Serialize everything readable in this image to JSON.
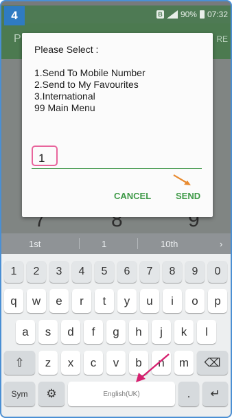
{
  "step_badge": "4",
  "status_bar": {
    "b_icon": "B",
    "battery": "90%",
    "time": "07:32"
  },
  "app_behind": {
    "left_text": "P",
    "right_text": "RE",
    "digits": [
      "7",
      "8",
      "9"
    ]
  },
  "dialog": {
    "title": "Please Select :",
    "items": [
      "1.Send To Mobile Number",
      "2.Send to My Favourites",
      "3.International",
      "99 Main Menu"
    ],
    "input_value": "1",
    "cancel": "CANCEL",
    "send": "SEND"
  },
  "keyboard": {
    "suggestions": [
      "1st",
      "1",
      "10th"
    ],
    "suggestion_more": "›",
    "number_row": [
      "1",
      "2",
      "3",
      "4",
      "5",
      "6",
      "7",
      "8",
      "9",
      "0"
    ],
    "row1": [
      "q",
      "w",
      "e",
      "r",
      "t",
      "y",
      "u",
      "i",
      "o",
      "p"
    ],
    "row2": [
      "a",
      "s",
      "d",
      "f",
      "g",
      "h",
      "j",
      "k",
      "l"
    ],
    "row3": [
      "z",
      "x",
      "c",
      "v",
      "b",
      "n",
      "m"
    ],
    "shift": "⇧",
    "backspace": "⌫",
    "sym": "Sym",
    "settings": "⚙",
    "space": "English(UK)",
    "period": ".",
    "enter": "↵"
  },
  "colors": {
    "frame_border": "#4a8fd4",
    "status_bar": "#4e7a54",
    "dialog_accent": "#3f9a48",
    "highlight": "#e8659c",
    "arrow_orange": "#e88a2f",
    "arrow_pink": "#d6206f"
  }
}
